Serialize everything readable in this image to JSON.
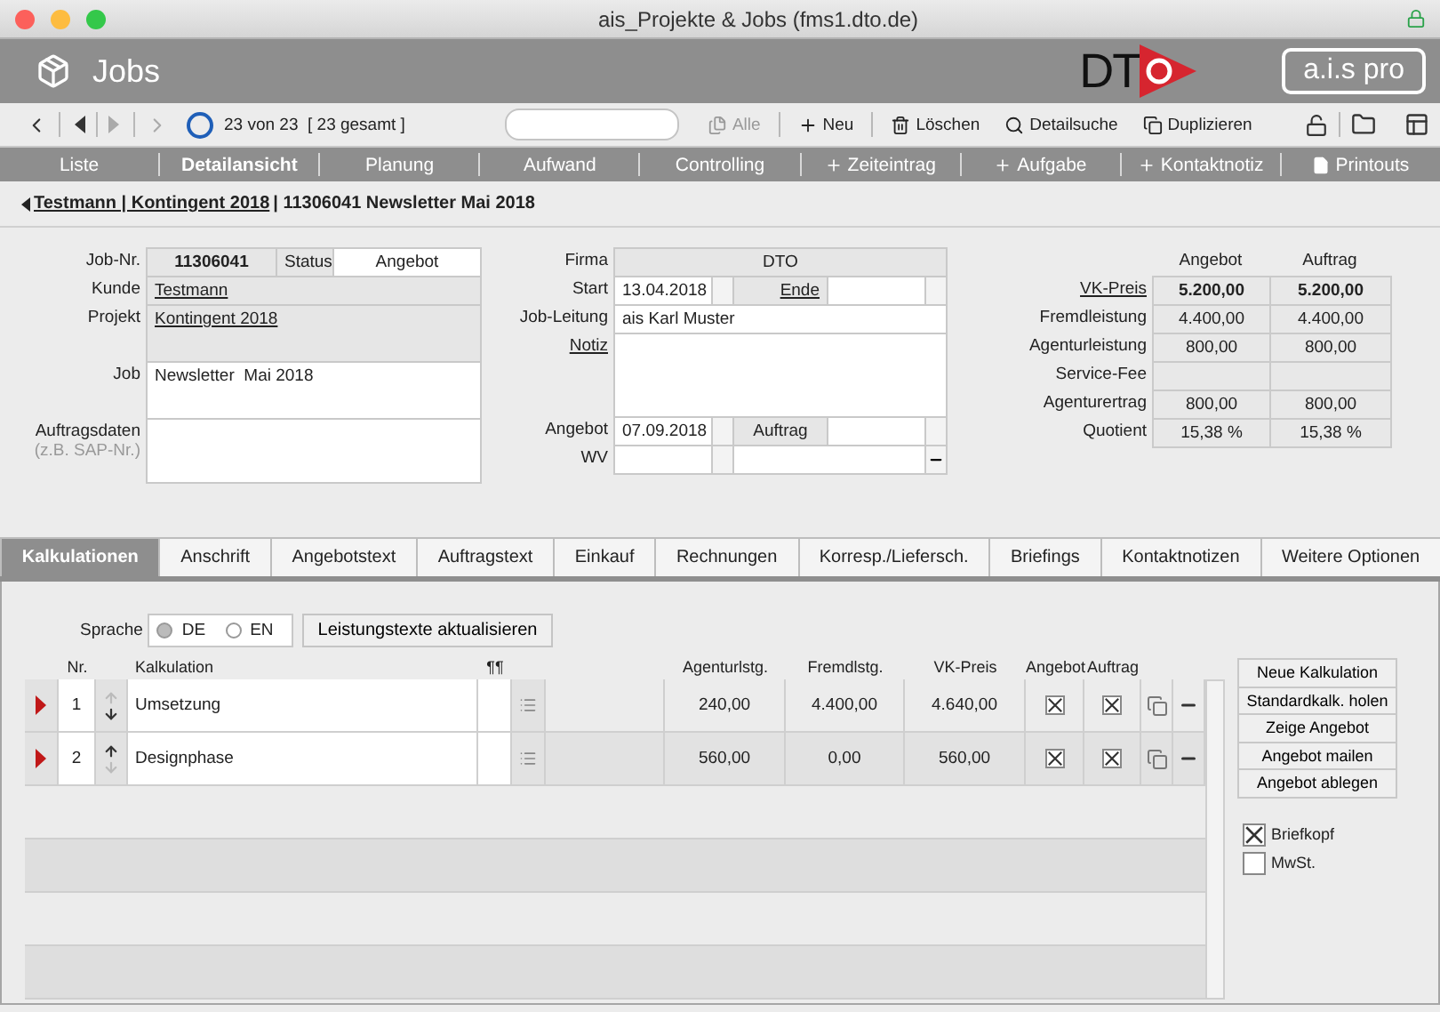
{
  "window": {
    "title": "ais_Projekte & Jobs (fms1.dto.de)"
  },
  "header": {
    "title": "Jobs",
    "logo": "DT",
    "product": "a.i.s pro"
  },
  "toolbar": {
    "record_info": "23 von 23  [ 23 gesamt ]",
    "buttons": [
      {
        "kind": "copy",
        "label": "Alle",
        "disabled": true
      },
      {
        "kind": "plus",
        "label": "Neu",
        "disabled": false
      },
      {
        "kind": "trash",
        "label": "Löschen",
        "disabled": false
      },
      {
        "kind": "search",
        "label": "Detailsuche",
        "disabled": false
      },
      {
        "kind": "duplicate",
        "label": "Duplizieren",
        "disabled": false
      }
    ]
  },
  "nav": {
    "items": [
      {
        "label": "Liste",
        "selected": false
      },
      {
        "label": "Detailansicht",
        "selected": true
      },
      {
        "label": "Planung",
        "selected": false
      },
      {
        "label": "Aufwand",
        "selected": false
      },
      {
        "label": "Controlling",
        "selected": false
      }
    ],
    "actions": [
      {
        "kind": "plus",
        "label": "Zeiteintrag"
      },
      {
        "kind": "plus",
        "label": "Aufgabe"
      },
      {
        "kind": "plus",
        "label": "Kontaktnotiz"
      },
      {
        "kind": "document",
        "label": "Printouts"
      }
    ]
  },
  "breadcrumb": {
    "link": "Testmann | Kontingent 2018",
    "text": "| 11306041 Newsletter  Mai 2018"
  },
  "job": {
    "job_nr": {
      "label": "Job-Nr.",
      "value": "11306041"
    },
    "status": {
      "label": "Status",
      "value": "Angebot"
    },
    "kunde": {
      "label": "Kunde",
      "value": "Testmann"
    },
    "projekt": {
      "label": "Projekt",
      "value": "Kontingent 2018"
    },
    "job": {
      "label": "Job",
      "value": "Newsletter  Mai 2018"
    },
    "auftragsdaten": {
      "label": "Auftragsdaten",
      "hint": "(z.B. SAP-Nr.)"
    },
    "firma": {
      "label": "Firma",
      "value": "DTO"
    },
    "start": {
      "label": "Start",
      "value": "13.04.2018"
    },
    "ende": {
      "label": "Ende"
    },
    "job_leitung": {
      "label": "Job-Leitung",
      "value": "ais Karl Muster"
    },
    "notiz": {
      "label": "Notiz"
    },
    "angebot": {
      "label": "Angebot",
      "value": "07.09.2018"
    },
    "auftrag": {
      "label": "Auftrag"
    },
    "wv": {
      "label": "WV"
    }
  },
  "totals": {
    "columns": [
      "Angebot",
      "Auftrag"
    ],
    "rows": [
      {
        "label": "VK-Preis",
        "link": true,
        "bold": true,
        "values": [
          "5.200,00",
          "5.200,00"
        ]
      },
      {
        "label": "Fremdleistung",
        "link": false,
        "bold": false,
        "values": [
          "4.400,00",
          "4.400,00"
        ]
      },
      {
        "label": "Agenturleistung",
        "link": false,
        "bold": false,
        "values": [
          "800,00",
          "800,00"
        ]
      },
      {
        "label": "Service-Fee",
        "link": false,
        "values": []
      },
      {
        "label": "Agenturertrag",
        "link": false,
        "bold": false,
        "values": [
          "800,00",
          "800,00"
        ]
      },
      {
        "label": "Quotient",
        "link": false,
        "bold": false,
        "values": [
          "15,38 %",
          "15,38 %"
        ]
      }
    ]
  },
  "tabs": [
    {
      "label": "Kalkulationen",
      "selected": true
    },
    {
      "label": "Anschrift",
      "selected": false
    },
    {
      "label": "Angebotstext",
      "selected": false
    },
    {
      "label": "Auftragstext",
      "selected": false
    },
    {
      "label": "Einkauf",
      "selected": false
    },
    {
      "label": "Rechnungen",
      "selected": false
    },
    {
      "label": "Korresp./Liefersch.",
      "selected": false
    },
    {
      "label": "Briefings",
      "selected": false
    },
    {
      "label": "Kontaktnotizen",
      "selected": false
    },
    {
      "label": "Weitere Optionen",
      "selected": false
    }
  ],
  "kalkulation": {
    "language": {
      "label": "Sprache",
      "options": [
        {
          "label": "DE",
          "selected": true
        },
        {
          "label": "EN",
          "selected": false
        }
      ]
    },
    "update_button": "Leistungstexte aktualisieren",
    "columns": {
      "nr": "Nr.",
      "name": "Kalkulation",
      "para": "¶¶",
      "agentur": "Agenturlstg.",
      "fremd": "Fremdlstg.",
      "vk": "VK-Preis",
      "angebot": "Angebot",
      "auftrag": "Auftrag"
    },
    "rows": [
      {
        "nr": "1",
        "name": "Umsetzung",
        "agentur": "240,00",
        "fremd": "4.400,00",
        "vk": "4.640,00",
        "angebot": true,
        "auftrag": true,
        "up_enabled": false,
        "down_enabled": true
      },
      {
        "nr": "2",
        "name": "Designphase",
        "agentur": "560,00",
        "fremd": "0,00",
        "vk": "560,00",
        "angebot": true,
        "auftrag": true,
        "up_enabled": true,
        "down_enabled": false
      }
    ],
    "actions": [
      "Neue Kalkulation",
      "Standardkalk. holen",
      "Zeige Angebot",
      "Angebot mailen",
      "Angebot ablegen"
    ],
    "options": [
      {
        "label": "Briefkopf",
        "checked": true
      },
      {
        "label": "MwSt.",
        "checked": false
      }
    ]
  }
}
